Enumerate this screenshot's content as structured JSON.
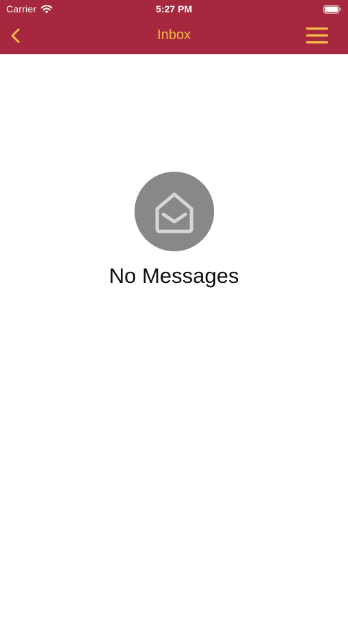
{
  "status_bar": {
    "carrier": "Carrier",
    "time": "5:27 PM",
    "wifi_icon": "wifi-icon",
    "battery_icon": "battery-icon"
  },
  "nav_bar": {
    "title": "Inbox",
    "back_icon": "chevron-left-icon",
    "menu_icon": "hamburger-menu-icon",
    "background_color": "#a6283e",
    "accent_color": "#f5b945"
  },
  "empty_state": {
    "icon": "open-envelope-icon",
    "text": "No Messages",
    "circle_color": "#888888"
  }
}
